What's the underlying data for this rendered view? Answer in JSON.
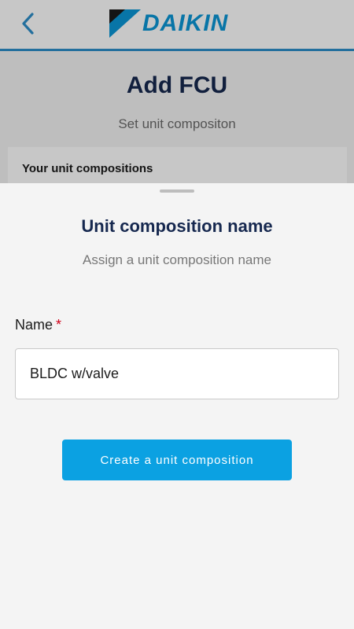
{
  "header": {
    "back_icon": "chevron-left-icon",
    "logo_text": "DAIKIN",
    "logo_icon": "daikin-triangle-logo-icon",
    "accent": "#2e8fc9",
    "brand_blue": "#0b97d6"
  },
  "page": {
    "title": "Add FCU",
    "subtitle": "Set unit compositon",
    "compositions_heading": "Your unit compositions"
  },
  "sheet": {
    "title": "Unit composition name",
    "subtitle": "Assign a unit composition name",
    "field_label": "Name",
    "required_mark": "*",
    "name_value": "BLDC w/valve",
    "button_label": "Create a unit composition",
    "button_color": "#0ba1e2"
  }
}
